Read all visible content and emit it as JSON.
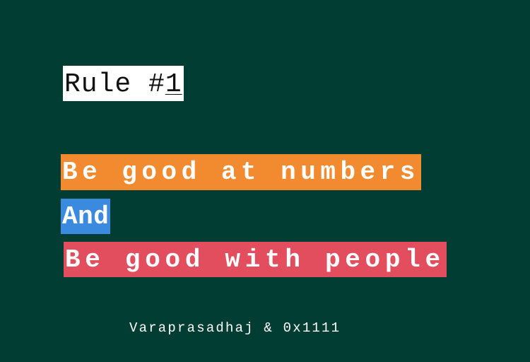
{
  "background_color": "#023d33",
  "rule": {
    "prefix": "Rule #",
    "number": "1"
  },
  "lines": {
    "numbers": {
      "text": "Be good at numbers",
      "highlight_color": "#f28a30"
    },
    "and": {
      "text": "And",
      "highlight_color": "#3a8be0"
    },
    "people": {
      "text": "Be good with people",
      "highlight_color": "#e34e5e"
    }
  },
  "credit": "Varaprasadhaj & 0x1111"
}
